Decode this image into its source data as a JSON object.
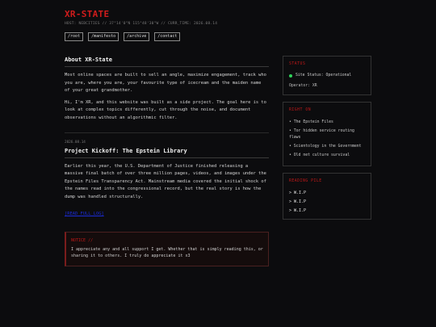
{
  "header": {
    "title": "XR-STATE",
    "host_line": "HOST: NEBCITIES // 37°14'0\"N 115°48'30\"W // CURR_TIME: 2026.08.14",
    "nav": [
      "/root",
      "/manifesto",
      "/archive",
      "/contact"
    ]
  },
  "about": {
    "heading": "About XR-State",
    "paragraphs": [
      "Most online spaces are built to sell an angle, maximize engagement, track who you are, where you are, your favourite type of icecream and the maiden name of your great grandmother.",
      "Hi, I'm XR, and this website was built as a side project. The goal here is to look at complex topics differently, cut through the noise, and document observations without an algorithmic filter."
    ]
  },
  "post": {
    "date": "2026.08.14",
    "title": "Project Kickoff: The Epstein Library",
    "body": "Earlier this year, the U.S. Department of Justice finished releasing a massive final batch of over three million pages, videos, and images under the Epstein Files Transparency Act. Mainstream media covered the initial shock of the names read into the congressional record, but the real story is how the dump was handled structurally.",
    "read_more": "[READ FULL LOG]"
  },
  "notice": {
    "title": "NOTICE //",
    "text": "I appreciate any and all support I get. Whether that is simply reading this, or sharing it to others. I truly do appreciate it x3"
  },
  "status": {
    "title": "STATUS",
    "site_status": "Site Status: Operational",
    "operator": "Operator: XR",
    "indicator_color": "#2fd35a"
  },
  "right_on": {
    "title": "RIGHT ON",
    "items": [
      "The Epstein Files",
      "Tor hidden service routing flaws",
      "Scientology in the Government",
      "Old net culture survival"
    ]
  },
  "reading_pile": {
    "title": "READING PILE",
    "items": [
      "> W.I.P",
      "> W.I.P",
      "> W.I.P"
    ]
  }
}
